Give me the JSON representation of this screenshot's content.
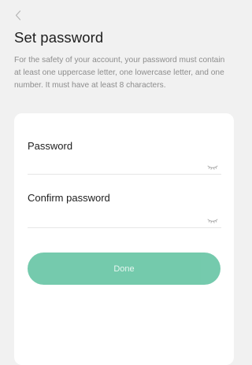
{
  "header": {
    "back_icon": "chevron-left-icon",
    "title": "Set password",
    "description": "For the safety of your account, your password must contain at least one uppercase letter, one lowercase letter, and one number. It must have at least 8 characters."
  },
  "form": {
    "password": {
      "label": "Password",
      "value": "",
      "visibility_icon": "eye-closed-icon"
    },
    "confirm_password": {
      "label": "Confirm password",
      "value": "",
      "visibility_icon": "eye-closed-icon"
    },
    "done_label": "Done"
  },
  "colors": {
    "background": "#f1f1f1",
    "card": "#ffffff",
    "accent": "#69c6a6",
    "muted_text": "#8d8d8d"
  }
}
